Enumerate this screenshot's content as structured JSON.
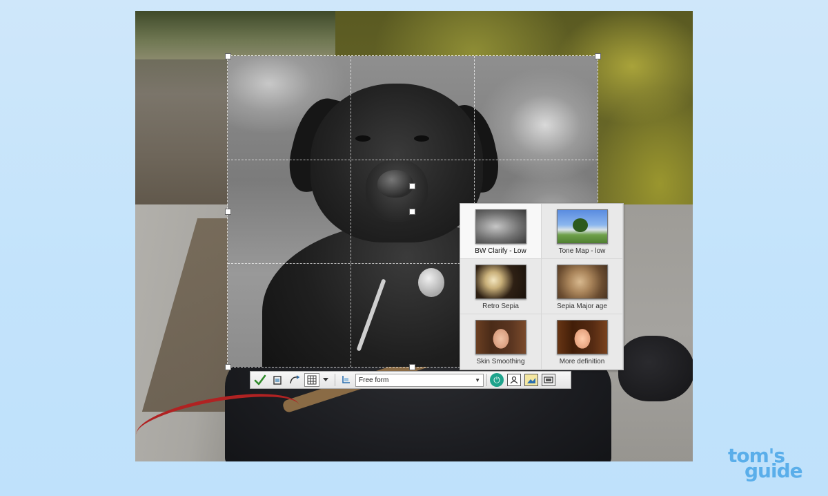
{
  "presets": [
    {
      "label": "BW Clarify - Low",
      "thumb": "bw-flower-thumbnail",
      "selected": true
    },
    {
      "label": "Tone Map - low",
      "thumb": "tree-landscape-thumbnail",
      "selected": false
    },
    {
      "label": "Retro Sepia",
      "thumb": "daisies-thumbnail",
      "selected": false
    },
    {
      "label": "Sepia Major age",
      "thumb": "sepia-flower-thumbnail",
      "selected": false
    },
    {
      "label": "Skin Smoothing",
      "thumb": "portrait-thumbnail",
      "selected": false
    },
    {
      "label": "More definition",
      "thumb": "portrait-thumbnail",
      "selected": false
    }
  ],
  "toolbar": {
    "apply_icon": "checkmark-icon",
    "crop_mode_select": {
      "value": "Free form"
    },
    "icons": [
      "checkmark-icon",
      "rotate-crop-icon",
      "straighten-icon",
      "grid-icon",
      "dropdown-arrow-icon",
      "aspect-ratio-icon",
      "power-icon",
      "portrait-icon",
      "landscape-icon",
      "fit-icon"
    ]
  },
  "watermark": {
    "line1": "tom's",
    "line2": "guide"
  },
  "colors": {
    "accent": "#1ea38c",
    "watermark": "#5aaeea",
    "background": "#c7e4fb"
  }
}
